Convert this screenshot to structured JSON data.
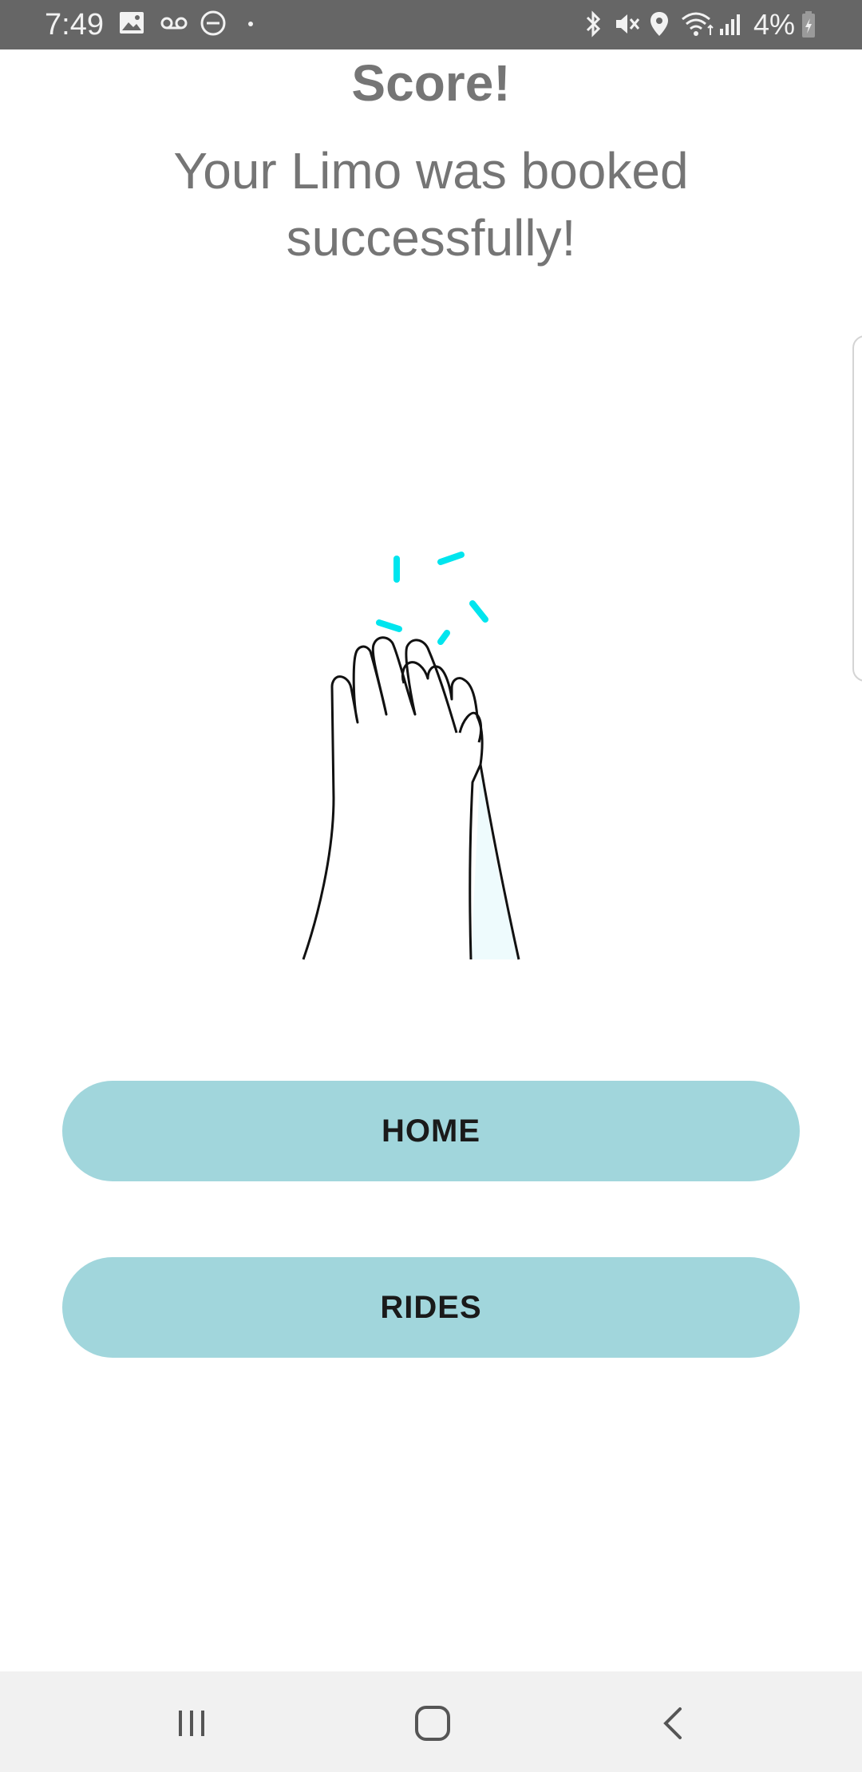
{
  "status_bar": {
    "time": "7:49",
    "battery_percent": "4%",
    "left_icons": [
      "image-icon",
      "voicemail-icon",
      "do-not-disturb-icon",
      "dot-icon"
    ],
    "right_icons": [
      "bluetooth-icon",
      "mute-icon",
      "location-icon",
      "wifi-icon",
      "signal-icon",
      "battery-charging-icon"
    ]
  },
  "main": {
    "title": "Score!",
    "message": "Your Limo was booked successfully!",
    "illustration": "high-five-icon",
    "accent_color": "#00e5ee"
  },
  "buttons": {
    "home_label": "HOME",
    "rides_label": "RIDES",
    "color": "#a1d6dc"
  },
  "nav_bar": {
    "items": [
      "recent-apps-icon",
      "home-icon",
      "back-icon"
    ]
  }
}
